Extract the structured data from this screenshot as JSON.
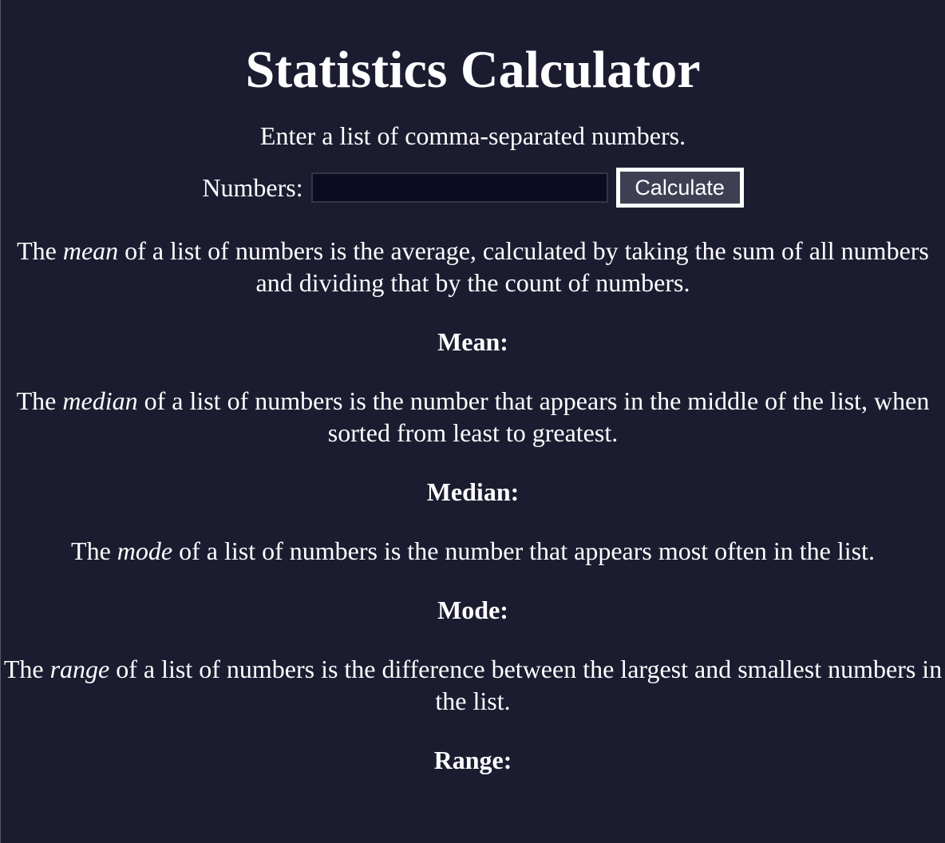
{
  "page": {
    "title": "Statistics Calculator",
    "intro": "Enter a list of comma-separated numbers."
  },
  "form": {
    "label": "Numbers:",
    "input_value": "",
    "button_label": "Calculate"
  },
  "sections": {
    "mean": {
      "desc_prefix": "The ",
      "term": "mean",
      "desc_suffix": " of a list of numbers is the average, calculated by taking the sum of all numbers and dividing that by the count of numbers.",
      "result_label": "Mean:"
    },
    "median": {
      "desc_prefix": "The ",
      "term": "median",
      "desc_suffix": " of a list of numbers is the number that appears in the middle of the list, when sorted from least to greatest.",
      "result_label": "Median:"
    },
    "mode": {
      "desc_prefix": "The ",
      "term": "mode",
      "desc_suffix": " of a list of numbers is the number that appears most often in the list.",
      "result_label": "Mode:"
    },
    "range": {
      "desc_prefix": "The ",
      "term": "range",
      "desc_suffix": " of a list of numbers is the difference between the largest and smallest numbers in the list.",
      "result_label": "Range:"
    }
  },
  "colors": {
    "background": "#1c1c31",
    "text": "#ffffff",
    "input_background": "#0b0b21",
    "button_background": "#3f3f54"
  }
}
